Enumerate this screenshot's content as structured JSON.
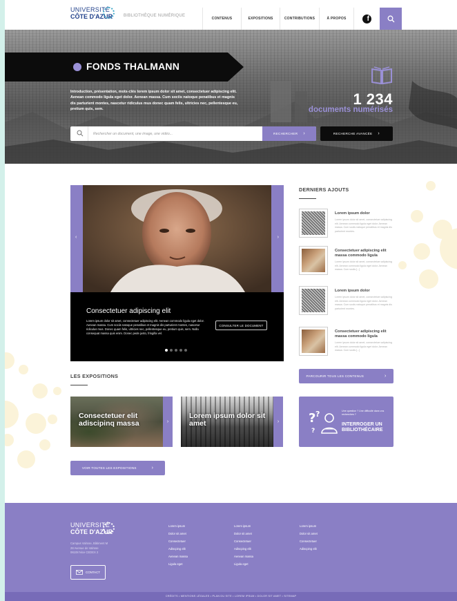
{
  "header": {
    "logo_line1": "UNIVERSITÉ",
    "logo_line2": "CÔTE D'AZUR",
    "site_name": "BIBLIOTHÈQUE NUMÉRIQUE",
    "nav": [
      {
        "label": "CONTENUS"
      },
      {
        "label": "EXPOSITIONS"
      },
      {
        "label": "CONTRIBUTIONS"
      },
      {
        "label": "À PROPOS"
      }
    ],
    "facebook_glyph": "f"
  },
  "hero": {
    "title": "FONDS THALMANN",
    "intro": "Introduction, présentation, mots-clés lorem ipsum dolor sit amet, consectetuer adipiscing elit. Aenean commodo ligula eget dolor. Aenean massa. Cum sociis natoque penatibus et magnis dis parturient montes, nascetur ridiculus mus donec quam felis, ultricies nec, pellentesque eu, pretium quis, sem.",
    "count": "1 234",
    "count_label": "documents numérisés",
    "search_placeholder": "Rechercher un document, une image, une vidéo...",
    "search_button": "RECHERCHER",
    "advanced_button": "RECHERCHE AVANCÉE"
  },
  "carousel": {
    "title": "Consectetuer adipiscing elit",
    "text": "Lorem ipsum dolor sit amet, consectetuer adipiscing elit. Aenean commodo ligula eget dolor. Aenean massa. Cum sociis natoque penatibus et magnis dis parturient montes, nascetur ridiculus mus. Donec quam felis, ultricies nec, pellentesque eu, pretium quis, sem. Nulla consequat massa quis enim. Donec pede justo, fringilla vel.",
    "button": "CONSULTER LE DOCUMENT",
    "arrow_prev": "‹",
    "arrow_next": "›"
  },
  "recent": {
    "heading": "DERNIERS AJOUTS",
    "items": [
      {
        "title": "Lorem ipsum dolor",
        "text": "Lorem ipsum dolor sit amet, consectetuer adipiscing elit. Aenean commodo ligula eget dolor. Aenean massa. Cum sociis natoque penatibus et magnis dis parturient montes."
      },
      {
        "title": "Consectetuer adipiscing elit massa commodo ligula",
        "text": "Lorem ipsum dolor sit amet, consectetuer adipiscing elit. Aenean commodo ligula eget dolor. Aenean massa. Cum sociis [...]"
      },
      {
        "title": "Lorem ipsum dolor",
        "text": "Lorem ipsum dolor sit amet, consectetuer adipiscing elit. Aenean commodo ligula eget dolor. Aenean massa. Cum sociis natoque penatibus et magnis dis parturient montes."
      },
      {
        "title": "Consectetuer adipiscing elit massa commodo ligula",
        "text": "Lorem ipsum dolor sit amet, consectetuer adipiscing elit. Aenean commodo ligula eget dolor. Aenean massa. Cum sociis [...]"
      }
    ],
    "browse_button": "PARCOURIR TOUS LES CONTENUS"
  },
  "expositions": {
    "heading": "LES EXPOSITIONS",
    "cards": [
      {
        "title": "Consectetuer elit adiscipinq massa"
      },
      {
        "title": "Lorem ipsum dolor sit amet"
      }
    ],
    "all_button": "VOIR TOUTES LES EXPOSITIONS"
  },
  "ask": {
    "question": "Une question ? Une difficulté dans vos recherches ?",
    "button": "INTERROGER UN BIBLIOTHÉCAIRE"
  },
  "footer": {
    "logo_line1": "UNIVERSITÉ",
    "logo_line2": "CÔTE D'AZUR",
    "address": [
      "Campus Valrose, Bâtiment M",
      "28 Avenue de Valrose",
      "06108 Nice CEDEX 2"
    ],
    "contact": "CONTACT",
    "col1": [
      "Lorem ipsum",
      "Dolor sit amet",
      "Consectetuer",
      "Adiscping elit",
      "Aenean massa",
      "Ligula eget"
    ],
    "col2": [
      "Lorem ipsum",
      "Dolor sit amet",
      "Consectetuer",
      "Adiscping elit",
      "Aenean massa",
      "Ligula eget"
    ],
    "col3": [
      "Lorem ipsum",
      "Dolor sit amet",
      "Consectetuer",
      "Adiscping elit"
    ],
    "bottom_links": "CRÉDITS  •  MENTIONS LÉGALES  •  PLAN DU SITE  •  LOREM IPSUM  •  DOLOR SIT AMET  •  SITEMAP"
  },
  "colors": {
    "accent": "#8a7fc5",
    "dark": "#0c0c0c",
    "footer": "#8a7fc5",
    "deco": "#fbf3d9"
  }
}
